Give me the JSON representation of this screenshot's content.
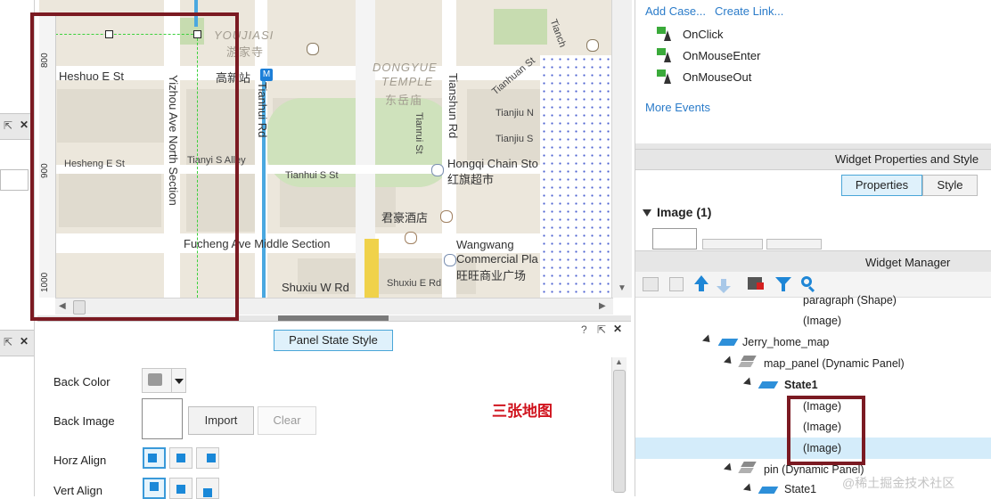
{
  "map": {
    "ruler_ticks": [
      "800",
      "900",
      "1000"
    ],
    "labels": {
      "youjiasi_en": "YOUJIASI",
      "youjiasi_cn": "游家寺",
      "dongyue_en": "DONGYUE",
      "temple_en": "TEMPLE",
      "dongyue_cn": "东岳庙",
      "heshuo": "Heshuo E St",
      "gaoxin": "高新站",
      "metro": "M",
      "tianhui_rd": "Tianhui Rd",
      "tianshun_rd": "Tianshun Rd",
      "tianchang": "Tianch",
      "tianhuan": "Tianhuan St",
      "tianjiu_n": "Tianjiu N",
      "tianjiu_s": "Tianjiu S",
      "tianrui": "Tianrui St",
      "yizhou": "Yizhou Ave North Section",
      "hesheng": "Hesheng E St",
      "tianyi": "Tianyi S Alley",
      "tianhui_s": "Tianhui S St",
      "hongqi_en": "Hongqi Chain Sto",
      "hongqi_cn": "红旗超市",
      "junhao": "君豪酒店",
      "fucheng": "Fucheng Ave Middle Section",
      "wangwang": "Wangwang",
      "commercial": "Commercial Pla",
      "wangwang_cn": "旺旺商业广场",
      "shuxiu_w": "Shuxiu W Rd",
      "shuxiu_e": "Shuxiu E Rd"
    }
  },
  "left_panel": {
    "tab_label": "Panel State Style",
    "back_color_label": "Back Color",
    "back_image_label": "Back Image",
    "import_label": "Import",
    "clear_label": "Clear",
    "horz_align_label": "Horz Align",
    "vert_align_label": "Vert Align",
    "annotation": "三张地图",
    "help": "?",
    "pin": "⇱",
    "close": "✕"
  },
  "left_strip": {
    "pin1": "⇱",
    "close1": "✕",
    "pin2": "⇱",
    "close2": "✕"
  },
  "right_pane": {
    "add_case": "Add Case...",
    "create_link": "Create Link...",
    "events": [
      "OnClick",
      "OnMouseEnter",
      "OnMouseOut"
    ],
    "more_events": "More Events",
    "props_title": "Widget Properties and Style",
    "tab_properties": "Properties",
    "tab_style": "Style",
    "image_heading": "Image (1)",
    "manager_title": "Widget Manager",
    "tree": {
      "paragraph": "paragraph (Shape)",
      "image_top": "(Image)",
      "jerry": "Jerry_home_map",
      "map_panel": "map_panel (Dynamic Panel)",
      "state1": "State1",
      "img1": "(Image)",
      "img2": "(Image)",
      "img3": "(Image)",
      "pin": "pin (Dynamic Panel)",
      "state1b": "State1"
    },
    "watermark": "@稀土掘金技术社区"
  },
  "colors": {
    "accent_blue": "#2a7bc9",
    "highlight_box": "#7b1a22",
    "annotation_red": "#d0141e",
    "selected_row": "#d4ecfa"
  }
}
